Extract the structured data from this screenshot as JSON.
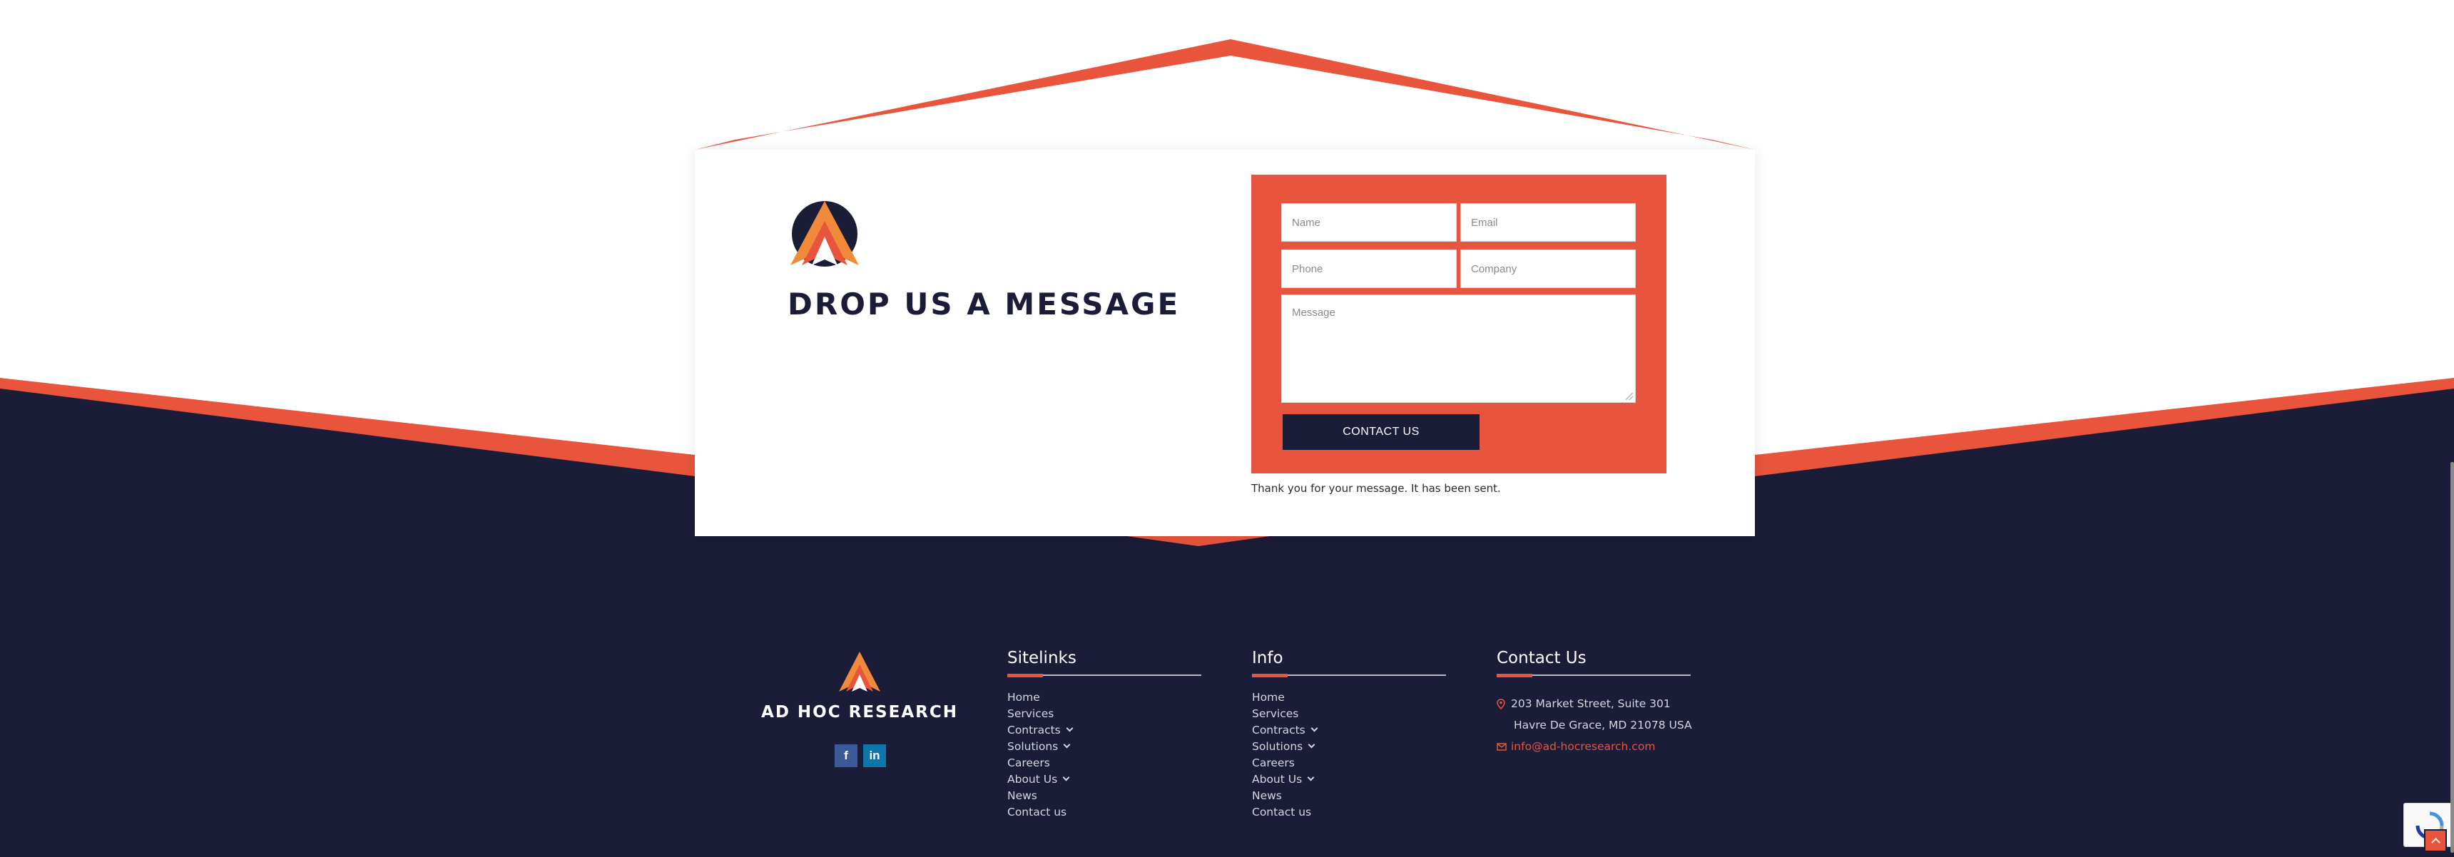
{
  "contact_section": {
    "title": "DROP US A MESSAGE",
    "form": {
      "name_placeholder": "Name",
      "email_placeholder": "Email",
      "phone_placeholder": "Phone",
      "company_placeholder": "Company",
      "message_placeholder": "Message",
      "submit_label": "CONTACT US",
      "response_message": "Thank you for your message. It has been sent."
    }
  },
  "footer": {
    "brand_name": "AD HOC RESEARCH",
    "social": [
      {
        "icon": "facebook-icon",
        "glyph": "f"
      },
      {
        "icon": "linkedin-icon",
        "glyph": "in"
      }
    ],
    "sitelinks": {
      "heading": "Sitelinks",
      "items": [
        {
          "label": "Home",
          "has_dropdown": false
        },
        {
          "label": "Services",
          "has_dropdown": false
        },
        {
          "label": "Contracts",
          "has_dropdown": true
        },
        {
          "label": "Solutions",
          "has_dropdown": true
        },
        {
          "label": "Careers",
          "has_dropdown": false
        },
        {
          "label": "About Us",
          "has_dropdown": true
        },
        {
          "label": "News",
          "has_dropdown": false
        },
        {
          "label": "Contact us",
          "has_dropdown": false
        }
      ]
    },
    "info": {
      "heading": "Info",
      "items": [
        {
          "label": "Home",
          "has_dropdown": false
        },
        {
          "label": "Services",
          "has_dropdown": false
        },
        {
          "label": "Contracts",
          "has_dropdown": true
        },
        {
          "label": "Solutions",
          "has_dropdown": true
        },
        {
          "label": "Careers",
          "has_dropdown": false
        },
        {
          "label": "About Us",
          "has_dropdown": true
        },
        {
          "label": "News",
          "has_dropdown": false
        },
        {
          "label": "Contact us",
          "has_dropdown": false
        }
      ]
    },
    "contact": {
      "heading": "Contact Us",
      "address_line1": "203 Market Street, Suite 301",
      "address_line2": "Havre De Grace, MD 21078 USA",
      "email": "info@ad-hocresearch.com"
    }
  },
  "colors": {
    "accent": "#e8553c",
    "navy": "#1a1c38",
    "white": "#ffffff"
  }
}
